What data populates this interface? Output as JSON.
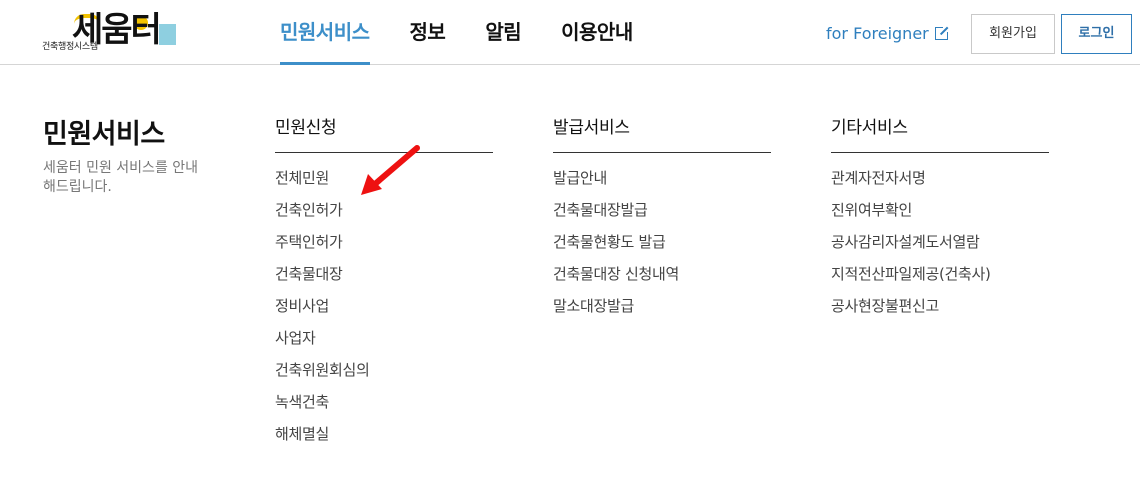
{
  "header": {
    "logo": {
      "main": "세움터",
      "sub": "건축행정시스템"
    },
    "nav": [
      {
        "label": "민원서비스",
        "active": true
      },
      {
        "label": "정보",
        "active": false
      },
      {
        "label": "알림",
        "active": false
      },
      {
        "label": "이용안내",
        "active": false
      }
    ],
    "foreigner_link": "for Foreigner",
    "join_button": "회원가입",
    "login_button": "로그인"
  },
  "intro": {
    "title": "민원서비스",
    "description": "세움터 민원 서비스를 안내해드립니다."
  },
  "columns": [
    {
      "title": "민원신청",
      "items": [
        "전체민원",
        "건축인허가",
        "주택인허가",
        "건축물대장",
        "정비사업",
        "사업자",
        "건축위원회심의",
        "녹색건축",
        "해체멸실"
      ]
    },
    {
      "title": "발급서비스",
      "items": [
        "발급안내",
        "건축물대장발급",
        "건축물현황도 발급",
        "건축물대장 신청내역",
        "말소대장발급"
      ]
    },
    {
      "title": "기타서비스",
      "items": [
        "관계자전자서명",
        "진위여부확인",
        "공사감리자설계도서열람",
        "지적전산파일제공(건축사)",
        "공사현장불편신고"
      ]
    }
  ],
  "colors": {
    "accent": "#3d8fc9",
    "annotation_arrow": "#ee1111"
  }
}
